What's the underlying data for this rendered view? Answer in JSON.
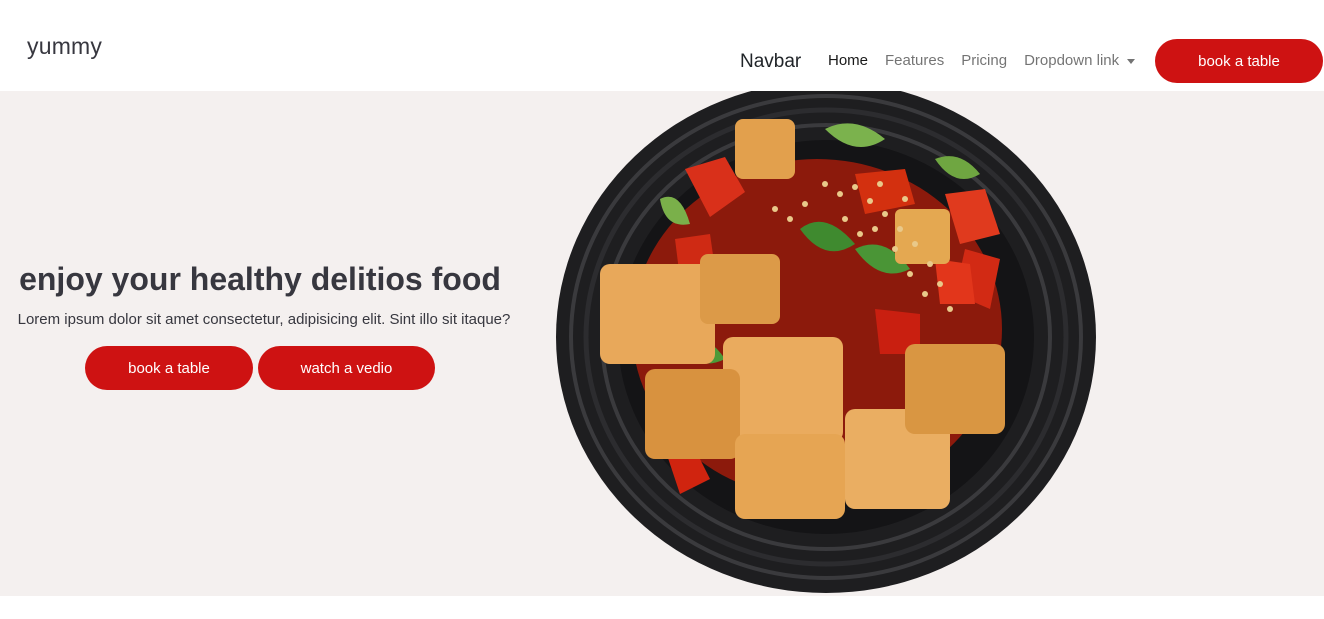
{
  "header": {
    "brand": "yummy",
    "navbar_brand": "Navbar",
    "nav": [
      {
        "label": "Home",
        "active": true
      },
      {
        "label": "Features",
        "active": false
      },
      {
        "label": "Pricing",
        "active": false
      },
      {
        "label": "Dropdown link",
        "active": false,
        "dropdown": true
      }
    ],
    "cta_label": "book a table"
  },
  "hero": {
    "title": "enjoy your healthy delitios food",
    "text": "Lorem ipsum dolor sit amet consectetur, adipisicing elit. Sint illo sit itaque?",
    "book_label": "book a table",
    "video_label": "watch a vedio",
    "image_icon": "food-dish-image"
  },
  "colors": {
    "accent": "#ce1212",
    "hero_bg": "#f4f0ef",
    "text": "#37373f"
  }
}
